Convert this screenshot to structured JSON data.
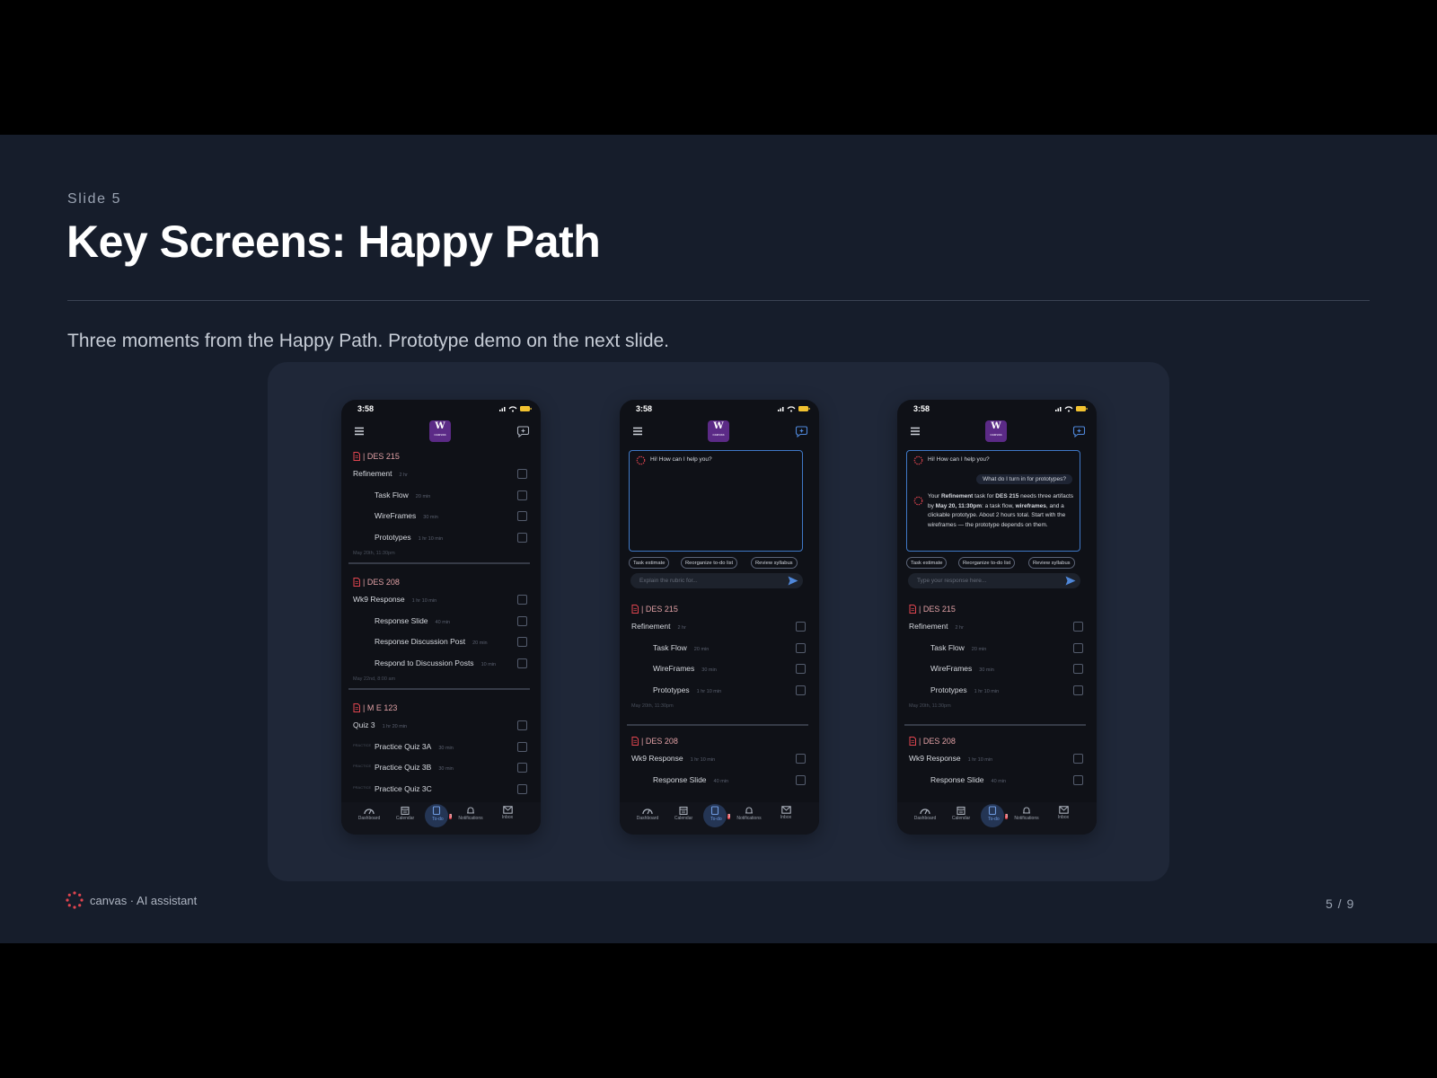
{
  "slide": {
    "label": "Slide 5",
    "title": "Key Screens: Happy Path",
    "subtitle": "Three moments from the Happy Path. Prototype demo on the next slide.",
    "footer_brand": "canvas · AI assistant",
    "page_indicator": "5 / 9"
  },
  "colors": {
    "slide_bg": "#161d2b",
    "panel_bg": "#1f2738",
    "accent_red": "#e0454f",
    "accent_blue": "#3f78c6",
    "brand_purple": "#5b2a86"
  },
  "phone": {
    "status_time": "3:58",
    "logo_letter": "W",
    "logo_caption": "canvas",
    "tabs": [
      {
        "label": "Dashboard",
        "icon": "dashboard-icon"
      },
      {
        "label": "Calendar",
        "icon": "calendar-icon"
      },
      {
        "label": "To-do",
        "icon": "todo-icon",
        "badge": "3",
        "active": true
      },
      {
        "label": "Notifications",
        "icon": "bell-icon"
      },
      {
        "label": "Inbox",
        "icon": "mail-icon"
      }
    ]
  },
  "courses": {
    "des215": {
      "name": "| DES 215",
      "parent": {
        "label": "Refinement",
        "duration": "2 hr"
      },
      "tasks": [
        {
          "label": "Task Flow",
          "duration": "20 min"
        },
        {
          "label": "WireFrames",
          "duration": "30 min"
        },
        {
          "label": "Prototypes",
          "duration": "1 hr 10 min"
        }
      ],
      "due": "May 20th, 11:30pm"
    },
    "des208": {
      "name": "| DES 208",
      "parent": {
        "label": "Wk9 Response",
        "duration": "1 hr 10 min"
      },
      "tasks": [
        {
          "label": "Response Slide",
          "duration": "40 min"
        },
        {
          "label": "Response Discussion Post",
          "duration": "20 min"
        },
        {
          "label": "Respond to Discussion Posts",
          "duration": "10 min"
        }
      ],
      "due": "May 22nd, 8:00 am"
    },
    "me123": {
      "name": "| M E 123",
      "parent": {
        "label": "Quiz 3",
        "duration": "1 hr 20 min"
      },
      "tasks": [
        {
          "label": "Practice Quiz 3A",
          "duration": "30 min",
          "tag": "PRACTICE"
        },
        {
          "label": "Practice Quiz 3B",
          "duration": "30 min",
          "tag": "PRACTICE"
        },
        {
          "label": "Practice Quiz 3C",
          "duration": "",
          "tag": "PRACTICE"
        }
      ]
    }
  },
  "chat": {
    "greeting": "Hi! How can I help you?",
    "user_question": "What do I turn in for prototypes?",
    "answer_parts": [
      "Your ",
      "Refinement",
      " task for ",
      "DES 215",
      " needs three artifacts by ",
      "May 20, 11:30pm",
      ": a task flow, ",
      "wireframes",
      ", and a clickable prototype. About 2 hours total. Start with the wireframes — the prototype depends on them."
    ],
    "chips": [
      "Task estimate",
      "Reorganize to-do list",
      "Review syllabus"
    ],
    "placeholder_screen2": "Explain the rubric for...",
    "placeholder_screen3": "Type your response here..."
  }
}
